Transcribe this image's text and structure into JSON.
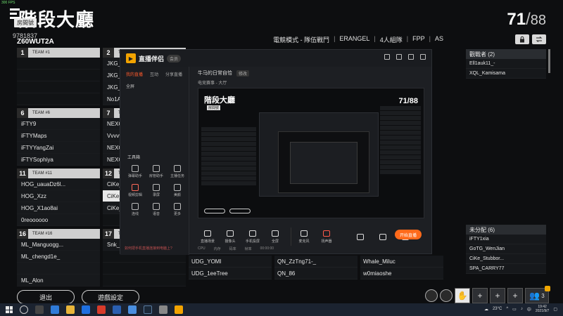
{
  "fps": "300 FPS",
  "header": {
    "title": "階段大廳",
    "host_badge": "房間號",
    "room_id": "9781837",
    "room_code": "Z60WUT2A",
    "player_count_current": "71",
    "player_count_max": "88",
    "mode_items": [
      "電競模式 - 隊伍戰鬥",
      "ERANGEL",
      "4人組隊",
      "FPP",
      "AS"
    ]
  },
  "teams": {
    "col1": [
      {
        "num": "1",
        "name": "TEAM #1",
        "slots": [
          "",
          "",
          "",
          ""
        ]
      },
      {
        "num": "6",
        "name": "TEAM #6",
        "slots": [
          "iFTY9",
          "iFTYMaps",
          "iFTYYangZai",
          "iFTYSophiya"
        ]
      },
      {
        "num": "11",
        "name": "TEAM #11",
        "slots": [
          "HOG_uauaDz6l...",
          "HOG_Xzz",
          "HOG_X1ao8ai",
          "0reoooooo"
        ]
      },
      {
        "num": "16",
        "name": "TEAM #16",
        "slots": [
          "ML_Manguogg...",
          "ML_chengd1e_",
          "",
          "ML_Alon"
        ]
      }
    ],
    "col2": [
      {
        "num": "2",
        "name": "TEAM #2",
        "slots": [
          "JKG_",
          "JKG_",
          "JKG_",
          "No1A"
        ]
      },
      {
        "num": "7",
        "name": "TEAM #7",
        "slots": [
          "NEXO",
          "Vvvvv",
          "NEXO",
          "NEXO"
        ]
      },
      {
        "num": "12",
        "name": "TEAM #12",
        "slots": [
          "CiKe_",
          "CiKe_",
          "CiKe_",
          ""
        ]
      },
      {
        "num": "17",
        "name": "TEAM #17",
        "slots": [
          "Snk_T",
          "",
          "",
          ""
        ]
      }
    ]
  },
  "bottom_names": {
    "col3": [
      "UDG_YOMI",
      "UDG_1eeTree"
    ],
    "col4": [
      "QN_ZzTng71-_",
      "QN_86"
    ],
    "col5": [
      "Whale_Miluc",
      "w0miaoshe"
    ]
  },
  "observers": {
    "title": "觀戰者 (2)",
    "items": [
      "Ell1auk11_-",
      "XQL_Kamisama"
    ]
  },
  "unassigned": {
    "title": "未分配 (6)",
    "items": [
      "iFTY1xia",
      "GoTG_WenJian",
      "CiKe_Stubbor...",
      "SPA_CARRY77"
    ]
  },
  "buttons": {
    "exit": "退出",
    "settings": "遊戲設定"
  },
  "quick_slots": {
    "count": "3"
  },
  "stream_app": {
    "name": "直播伴侣",
    "vip": "会员",
    "tabs": [
      "我的直播",
      "互动",
      "分享直播"
    ],
    "sub": [
      "全屏"
    ],
    "room_title": "牛马的日常自恰",
    "edit": "修改",
    "room_meta": "电竞赛事 - 大厅",
    "tools_label": "工具箱",
    "tools": [
      "弹幕助手",
      "房管助手",
      "主播任务",
      "视频剪辑",
      "录屏",
      "美颜",
      "连线",
      "语音",
      "更多"
    ],
    "note": "如何把手机直播连接到电脑上?",
    "controls": [
      "直播场景",
      "摄像头",
      "手机投屏",
      "全屏",
      "麦克风",
      "扬声器",
      "",
      "",
      ""
    ],
    "go_live": "开始直播",
    "status": [
      "CPU",
      "内存",
      "码率",
      "帧率",
      "00:00:00"
    ]
  },
  "preview": {
    "title": "階段大廳",
    "badge": "房間號",
    "count": "71/88"
  },
  "taskbar": {
    "temp": "23°C",
    "time": "19:42",
    "date": "2021/9/7"
  }
}
